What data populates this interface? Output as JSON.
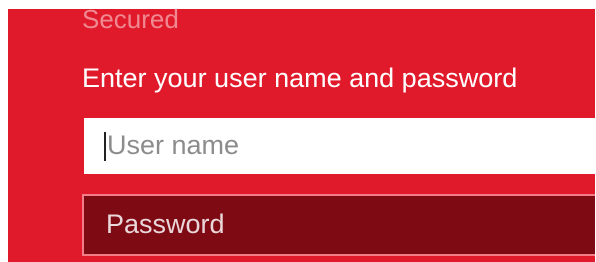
{
  "header": {
    "secured_label": "Secured",
    "prompt": "Enter your user name and password"
  },
  "form": {
    "username": {
      "placeholder": "User name",
      "value": ""
    },
    "password": {
      "placeholder": "Password",
      "value": ""
    }
  },
  "colors": {
    "background": "#e11a2b",
    "password_field": "#7e0a14",
    "password_border": "#f27d88",
    "secured_text": "#f08891"
  }
}
